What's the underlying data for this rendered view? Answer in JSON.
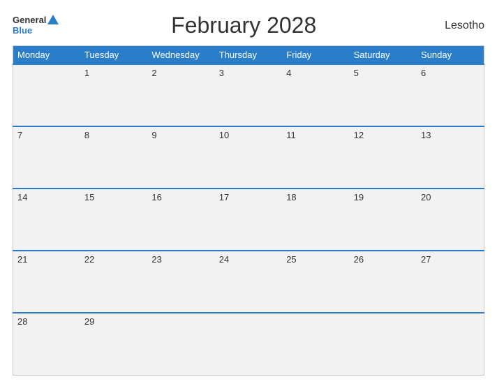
{
  "header": {
    "title": "February 2028",
    "country": "Lesotho",
    "logo_general": "General",
    "logo_blue": "Blue"
  },
  "calendar": {
    "days_of_week": [
      "Monday",
      "Tuesday",
      "Wednesday",
      "Thursday",
      "Friday",
      "Saturday",
      "Sunday"
    ],
    "weeks": [
      [
        null,
        1,
        2,
        3,
        4,
        5,
        6
      ],
      [
        7,
        8,
        9,
        10,
        11,
        12,
        13
      ],
      [
        14,
        15,
        16,
        17,
        18,
        19,
        20
      ],
      [
        21,
        22,
        23,
        24,
        25,
        26,
        27
      ],
      [
        28,
        29,
        null,
        null,
        null,
        null,
        null
      ]
    ]
  }
}
